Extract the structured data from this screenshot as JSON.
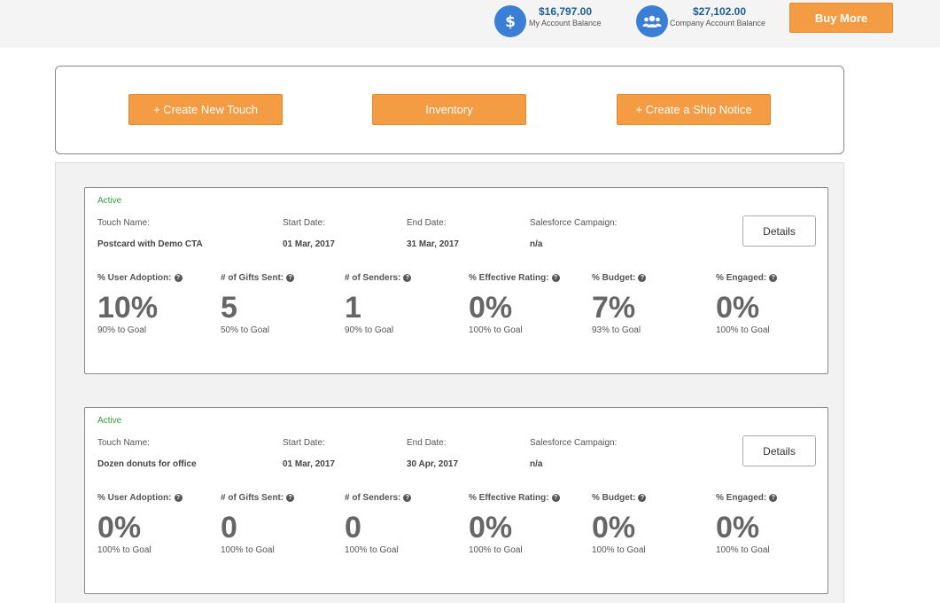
{
  "header": {
    "my_balance": {
      "amount": "$16,797.00",
      "label": "My Account Balance",
      "icon": "dollar-icon"
    },
    "company_balance": {
      "amount": "$27,102.00",
      "label": "Company Account Balance",
      "icon": "users-icon"
    },
    "buy_more_label": "Buy More"
  },
  "actions": {
    "create_touch": "+ Create New Touch",
    "inventory": "Inventory",
    "ship_notice": "+ Create a Ship Notice"
  },
  "touches": [
    {
      "status": "Active",
      "labels": {
        "name": "Touch Name:",
        "start": "Start Date:",
        "end": "End Date:",
        "campaign": "Salesforce Campaign:"
      },
      "name": "Postcard with Demo CTA",
      "start_date": "01 Mar, 2017",
      "end_date": "31 Mar, 2017",
      "campaign": "n/a",
      "details_label": "Details",
      "metrics": [
        {
          "label": "% User Adoption:",
          "value": "10%",
          "goal": "90% to Goal"
        },
        {
          "label": "# of Gifts Sent:",
          "value": "5",
          "goal": "50% to Goal"
        },
        {
          "label": "# of Senders:",
          "value": "1",
          "goal": "90% to Goal"
        },
        {
          "label": "% Effective Rating:",
          "value": "0%",
          "goal": "100% to Goal"
        },
        {
          "label": "% Budget:",
          "value": "7%",
          "goal": "93% to Goal"
        },
        {
          "label": "% Engaged:",
          "value": "0%",
          "goal": "100% to Goal"
        }
      ]
    },
    {
      "status": "Active",
      "labels": {
        "name": "Touch Name:",
        "start": "Start Date:",
        "end": "End Date:",
        "campaign": "Salesforce Campaign:"
      },
      "name": "Dozen donuts for office",
      "start_date": "01 Mar, 2017",
      "end_date": "30 Apr, 2017",
      "campaign": "n/a",
      "details_label": "Details",
      "metrics": [
        {
          "label": "% User Adoption:",
          "value": "0%",
          "goal": "100% to Goal"
        },
        {
          "label": "# of Gifts Sent:",
          "value": "0",
          "goal": "100% to Goal"
        },
        {
          "label": "# of Senders:",
          "value": "0",
          "goal": "100% to Goal"
        },
        {
          "label": "% Effective Rating:",
          "value": "0%",
          "goal": "100% to Goal"
        },
        {
          "label": "% Budget:",
          "value": "0%",
          "goal": "100% to Goal"
        },
        {
          "label": "% Engaged:",
          "value": "0%",
          "goal": "100% to Goal"
        }
      ]
    }
  ]
}
